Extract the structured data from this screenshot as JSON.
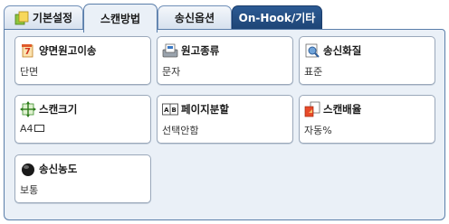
{
  "tabs": [
    {
      "label": "기본설정",
      "icon": "copy-icon"
    },
    {
      "label": "스캔방법"
    },
    {
      "label": "송신옵션"
    },
    {
      "label": "On-Hook/기타"
    }
  ],
  "buttons": [
    {
      "title": "양면원고이송",
      "value": "단면",
      "icon": "duplex-original-icon"
    },
    {
      "title": "원고종류",
      "value": "문자",
      "icon": "original-type-icon"
    },
    {
      "title": "송신화질",
      "value": "표준",
      "icon": "resolution-icon"
    },
    {
      "title": "스캔크기",
      "value": "A4",
      "value_icon": "landscape-paper-icon",
      "icon": "scan-size-icon"
    },
    {
      "title": "페이지분할",
      "value": "선택안함",
      "icon": "page-split-icon"
    },
    {
      "title": "스캔배율",
      "value": "자동%",
      "icon": "reduce-enlarge-icon"
    },
    {
      "title": "송신농도",
      "value": "보통",
      "icon": "density-icon"
    }
  ],
  "colors": {
    "panel_bg": "#eaf0f7",
    "panel_border": "#5a7eaa",
    "dark_tab": "#1e4576"
  }
}
